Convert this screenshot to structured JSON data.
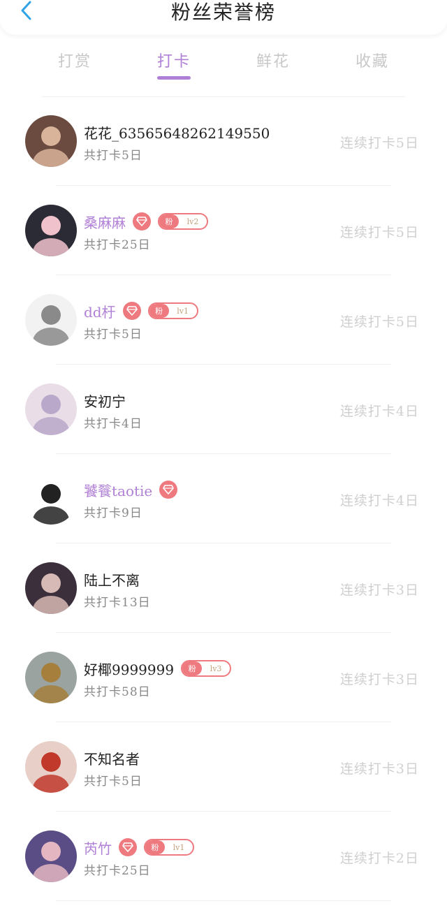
{
  "header": {
    "title": "粉丝荣誉榜",
    "back_icon": "chevron-left-icon"
  },
  "colors": {
    "accent": "#b07fd6",
    "badge": "#ee7a80",
    "back": "#2ea3e6"
  },
  "tabs": [
    {
      "label": "打赏",
      "active": false
    },
    {
      "label": "打卡",
      "active": true
    },
    {
      "label": "鲜花",
      "active": false
    },
    {
      "label": "收藏",
      "active": false
    }
  ],
  "rows": [
    {
      "name": "花花_63565648262149550",
      "purple": false,
      "diamond": false,
      "fan": "",
      "total": "共打卡5日",
      "streak": "连续打卡5日"
    },
    {
      "name": "桑麻麻",
      "purple": true,
      "diamond": true,
      "fan": "lv2",
      "total": "共打卡25日",
      "streak": "连续打卡5日"
    },
    {
      "name": "dd杅",
      "purple": true,
      "diamond": true,
      "fan": "lv1",
      "total": "共打卡5日",
      "streak": "连续打卡5日"
    },
    {
      "name": "安初宁",
      "purple": false,
      "diamond": false,
      "fan": "",
      "total": "共打卡4日",
      "streak": "连续打卡4日"
    },
    {
      "name": "饕餮taotie",
      "purple": true,
      "diamond": true,
      "fan": "",
      "total": "共打卡9日",
      "streak": "连续打卡4日"
    },
    {
      "name": "陆上不离",
      "purple": false,
      "diamond": false,
      "fan": "",
      "total": "共打卡13日",
      "streak": "连续打卡3日"
    },
    {
      "name": "好椰9999999",
      "purple": false,
      "diamond": false,
      "fan": "lv3",
      "total": "共打卡58日",
      "streak": "连续打卡3日"
    },
    {
      "name": "不知名者",
      "purple": false,
      "diamond": false,
      "fan": "",
      "total": "共打卡5日",
      "streak": "连续打卡3日"
    },
    {
      "name": "芮竹",
      "purple": true,
      "diamond": true,
      "fan": "lv1",
      "total": "共打卡25日",
      "streak": "连续打卡2日"
    }
  ],
  "fan_label": "粉"
}
